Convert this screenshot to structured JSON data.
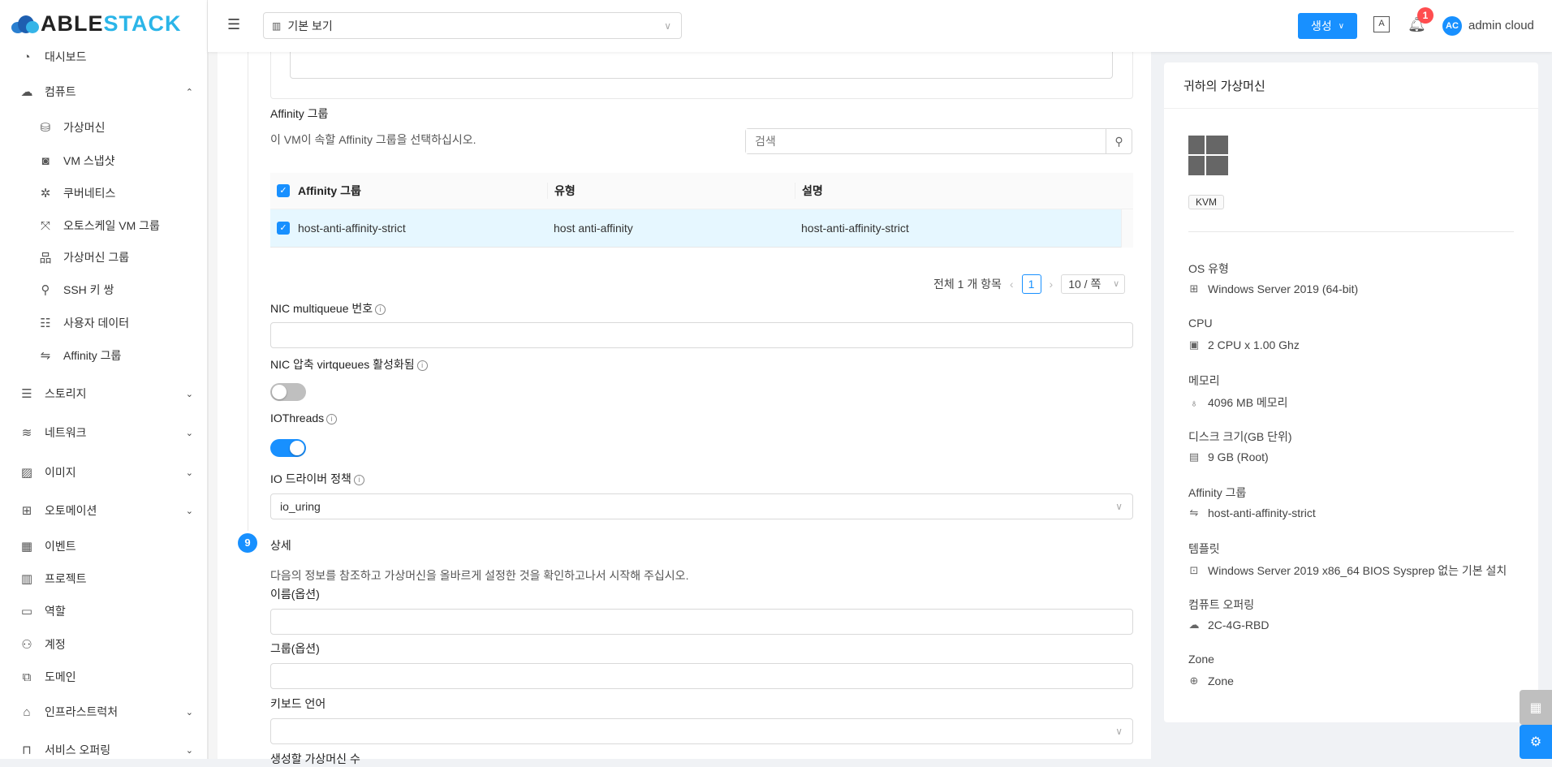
{
  "brand": {
    "part1": "ABLE",
    "part2": "STACK"
  },
  "colors": {
    "primary": "#1890ff",
    "badge": "#ff4d4f",
    "row_selected": "#e6f7ff"
  },
  "header": {
    "view_select": "기본 보기",
    "create_button": "생성",
    "notification_count": "1",
    "avatar_initials": "AC",
    "username": "admin cloud"
  },
  "sidebar": {
    "items": [
      {
        "label": "대시보드",
        "icon": "dashboard-icon",
        "glyph": "◔",
        "level": "top"
      },
      {
        "label": "컴퓨트",
        "icon": "cloud-icon",
        "glyph": "☁",
        "level": "top",
        "chevron": "^"
      },
      {
        "label": "가상머신",
        "icon": "vm-icon",
        "glyph": "⛁",
        "level": "sub"
      },
      {
        "label": "VM 스냅샷",
        "icon": "camera-icon",
        "glyph": "◙",
        "level": "sub"
      },
      {
        "label": "쿠버네티스",
        "icon": "kubernetes-icon",
        "glyph": "✲",
        "level": "sub"
      },
      {
        "label": "오토스케일 VM 그룹",
        "icon": "expand-icon",
        "glyph": "⤧",
        "level": "sub"
      },
      {
        "label": "가상머신 그룹",
        "icon": "cluster-icon",
        "glyph": "品",
        "level": "sub"
      },
      {
        "label": "SSH 키 쌍",
        "icon": "key-icon",
        "glyph": "⚲",
        "level": "sub"
      },
      {
        "label": "사용자 데이터",
        "icon": "solution-icon",
        "glyph": "☷",
        "level": "sub"
      },
      {
        "label": "Affinity 그룹",
        "icon": "swap-icon",
        "glyph": "⇋",
        "level": "sub"
      },
      {
        "label": "스토리지",
        "icon": "database-icon",
        "glyph": "☰",
        "level": "top",
        "chevron": "⌄"
      },
      {
        "label": "네트워크",
        "icon": "wifi-icon",
        "glyph": "≋",
        "level": "top",
        "chevron": "⌄"
      },
      {
        "label": "이미지",
        "icon": "picture-icon",
        "glyph": "▨",
        "level": "top",
        "chevron": "⌄"
      },
      {
        "label": "오토메이션",
        "icon": "appstore-add-icon",
        "glyph": "⊞",
        "level": "top",
        "chevron": "⌄"
      },
      {
        "label": "이벤트",
        "icon": "schedule-icon",
        "glyph": "▦",
        "level": "top"
      },
      {
        "label": "프로젝트",
        "icon": "project-icon",
        "glyph": "▥",
        "level": "top"
      },
      {
        "label": "역할",
        "icon": "idcard-icon",
        "glyph": "▭",
        "level": "top"
      },
      {
        "label": "계정",
        "icon": "team-icon",
        "glyph": "⚇",
        "level": "top"
      },
      {
        "label": "도메인",
        "icon": "block-icon",
        "glyph": "⧉",
        "level": "top"
      },
      {
        "label": "인프라스트럭처",
        "icon": "bank-icon",
        "glyph": "⌂",
        "level": "top",
        "chevron": "⌄"
      },
      {
        "label": "서비스 오퍼링",
        "icon": "shopping-icon",
        "glyph": "⊓",
        "level": "top",
        "chevron": "⌄"
      }
    ]
  },
  "form": {
    "affinity": {
      "title": "Affinity 그룹",
      "description": "이 VM이 속할 Affinity 그룹을 선택하십시오.",
      "search_placeholder": "검색",
      "columns": [
        "Affinity 그룹",
        "유형",
        "설명"
      ],
      "rows": [
        {
          "name": "host-anti-affinity-strict",
          "type": "host anti-affinity",
          "description": "host-anti-affinity-strict",
          "checked": true
        }
      ],
      "total": "전체 1 개 항목",
      "page": "1",
      "page_size": "10 / 쪽"
    },
    "nic_multiqueue_label": "NIC multiqueue 번호",
    "nic_multiqueue_value": "",
    "nic_packed_label": "NIC 압축 virtqueues 활성화됨",
    "nic_packed_enabled": false,
    "iothreads_label": "IOThreads",
    "iothreads_enabled": true,
    "io_driver_label": "IO 드라이버 정책",
    "io_driver_value": "io_uring",
    "step_number": "9",
    "step_title": "상세",
    "step_description": "다음의 정보를 참조하고 가상머신을 올바르게 설정한 것을 확인하고나서 시작해 주십시오.",
    "name_label": "이름(옵션)",
    "name_value": "",
    "group_label": "그룹(옵션)",
    "group_value": "",
    "keyboard_label": "키보드 언어",
    "keyboard_value": "",
    "count_label": "생성할 가상머신 수"
  },
  "summary": {
    "title": "귀하의 가상머신",
    "hypervisor": "KVM",
    "fields": [
      {
        "label": "OS 유형",
        "value": "Windows Server 2019 (64-bit)",
        "icon": "windows-icon",
        "glyph": "⊞"
      },
      {
        "label": "CPU",
        "value": "2 CPU x 1.00 Ghz",
        "icon": "appstore-icon",
        "glyph": "▣"
      },
      {
        "label": "메모리",
        "value": "4096 MB 메모리",
        "icon": "bulb-icon",
        "glyph": "♁"
      },
      {
        "label": "디스크 크기(GB 단위)",
        "value": "9 GB (Root)",
        "icon": "hdd-icon",
        "glyph": "▤"
      },
      {
        "label": "Affinity 그룹",
        "value": "host-anti-affinity-strict",
        "icon": "swap-icon",
        "glyph": "⇋"
      },
      {
        "label": "템플릿",
        "value": "Windows Server 2019 x86_64 BIOS Sysprep 없는 기본 설치",
        "icon": "save-icon",
        "glyph": "⊡"
      },
      {
        "label": "컴퓨트 오퍼링",
        "value": "2C-4G-RBD",
        "icon": "cloud-icon",
        "glyph": "☁"
      },
      {
        "label": "Zone",
        "value": "Zone",
        "icon": "global-icon",
        "glyph": "⊕"
      }
    ]
  }
}
